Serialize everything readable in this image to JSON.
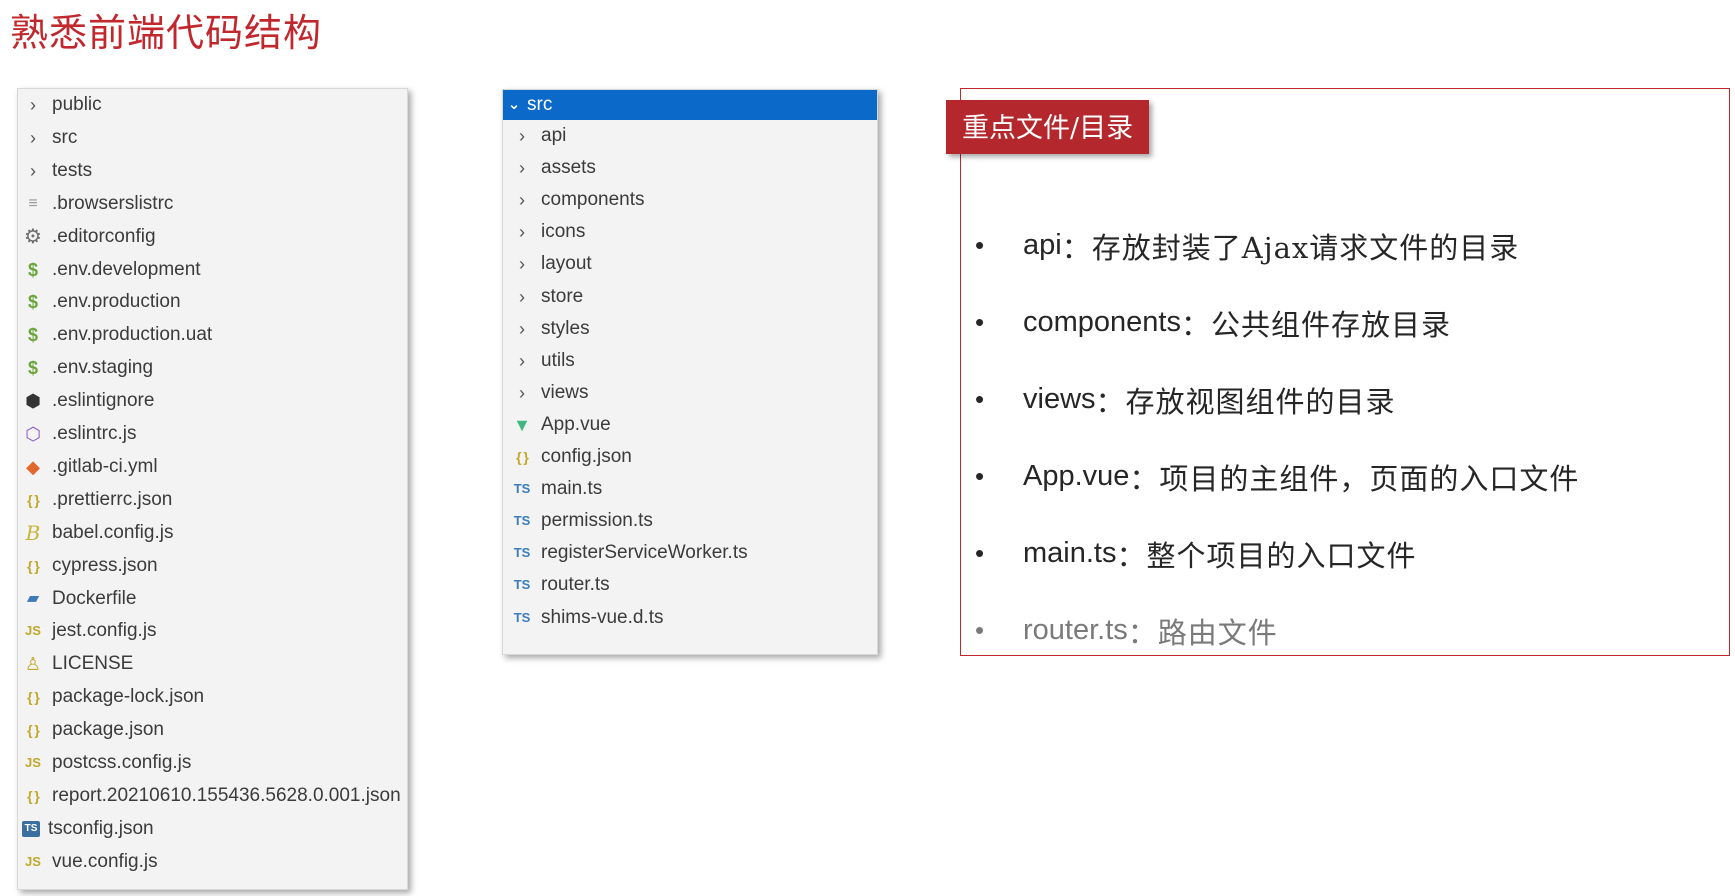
{
  "title": "熟悉前端代码结构",
  "root_explorer": {
    "items": [
      {
        "name": "public",
        "icon": "chevron-right-icon"
      },
      {
        "name": "src",
        "icon": "chevron-right-icon"
      },
      {
        "name": "tests",
        "icon": "chevron-right-icon"
      },
      {
        "name": ".browserslistrc",
        "icon": "text-file-icon"
      },
      {
        "name": ".editorconfig",
        "icon": "gear-icon"
      },
      {
        "name": ".env.development",
        "icon": "dollar-icon"
      },
      {
        "name": ".env.production",
        "icon": "dollar-icon"
      },
      {
        "name": ".env.production.uat",
        "icon": "dollar-icon"
      },
      {
        "name": ".env.staging",
        "icon": "dollar-icon"
      },
      {
        "name": ".eslintignore",
        "icon": "eslint-ignore-icon"
      },
      {
        "name": ".eslintrc.js",
        "icon": "eslint-icon"
      },
      {
        "name": ".gitlab-ci.yml",
        "icon": "gitlab-icon"
      },
      {
        "name": ".prettierrc.json",
        "icon": "json-icon"
      },
      {
        "name": "babel.config.js",
        "icon": "babel-icon"
      },
      {
        "name": "cypress.json",
        "icon": "json-icon"
      },
      {
        "name": "Dockerfile",
        "icon": "docker-icon"
      },
      {
        "name": "jest.config.js",
        "icon": "js-icon"
      },
      {
        "name": "LICENSE",
        "icon": "license-icon"
      },
      {
        "name": "package-lock.json",
        "icon": "json-icon"
      },
      {
        "name": "package.json",
        "icon": "json-icon"
      },
      {
        "name": "postcss.config.js",
        "icon": "js-icon"
      },
      {
        "name": "report.20210610.155436.5628.0.001.json",
        "icon": "json-icon"
      },
      {
        "name": "tsconfig.json",
        "icon": "tsconfig-icon"
      },
      {
        "name": "vue.config.js",
        "icon": "js-icon"
      }
    ]
  },
  "src_explorer": {
    "header": "src",
    "items": [
      {
        "name": "api",
        "icon": "chevron-right-icon"
      },
      {
        "name": "assets",
        "icon": "chevron-right-icon"
      },
      {
        "name": "components",
        "icon": "chevron-right-icon"
      },
      {
        "name": "icons",
        "icon": "chevron-right-icon"
      },
      {
        "name": "layout",
        "icon": "chevron-right-icon"
      },
      {
        "name": "store",
        "icon": "chevron-right-icon"
      },
      {
        "name": "styles",
        "icon": "chevron-right-icon"
      },
      {
        "name": "utils",
        "icon": "chevron-right-icon"
      },
      {
        "name": "views",
        "icon": "chevron-right-icon"
      },
      {
        "name": "App.vue",
        "icon": "vue-icon"
      },
      {
        "name": "config.json",
        "icon": "json-icon"
      },
      {
        "name": "main.ts",
        "icon": "ts-icon"
      },
      {
        "name": "permission.ts",
        "icon": "ts-icon"
      },
      {
        "name": "registerServiceWorker.ts",
        "icon": "ts-icon"
      },
      {
        "name": "router.ts",
        "icon": "ts-icon"
      },
      {
        "name": "shims-vue.d.ts",
        "icon": "ts-icon"
      }
    ]
  },
  "key_files": {
    "tag": "重点文件/目录",
    "items": [
      {
        "key": "api",
        "desc": "：存放封装了Ajax请求文件的目录"
      },
      {
        "key": "components",
        "desc": "：公共组件存放目录"
      },
      {
        "key": "views",
        "desc": "：存放视图组件的目录"
      },
      {
        "key": "App.vue",
        "desc": "：项目的主组件，页面的入口文件"
      },
      {
        "key": "main.ts",
        "desc": "：整个项目的入口文件"
      },
      {
        "key": "router.ts",
        "desc": "：路由文件"
      }
    ]
  },
  "colors": {
    "title": "#c0282d",
    "tag_bg": "#b4282d",
    "selected_row": "#0b6ac9"
  }
}
